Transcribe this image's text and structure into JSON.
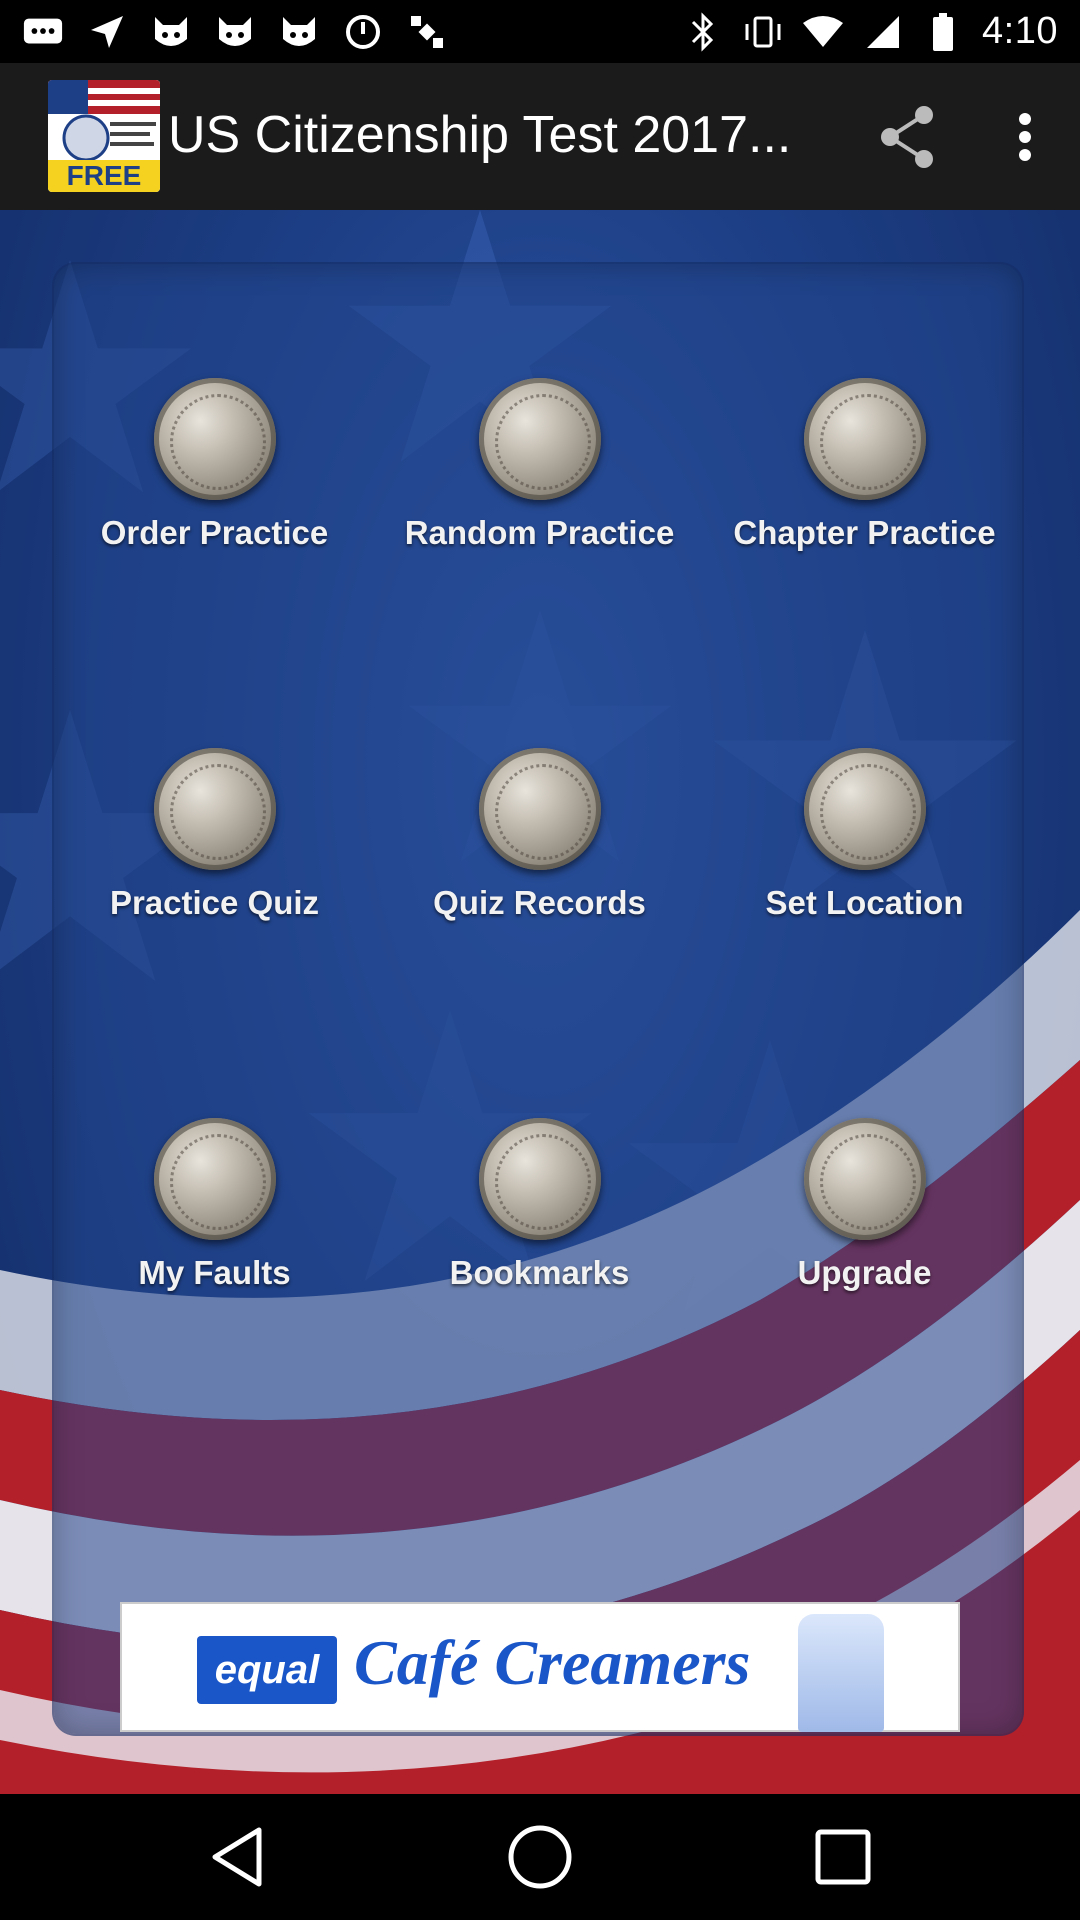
{
  "status_bar": {
    "time": "4:10"
  },
  "app_bar": {
    "logo_text": "FREE",
    "title": "US Citizenship Test 2017..."
  },
  "menu": {
    "items": [
      {
        "label": "Order Practice"
      },
      {
        "label": "Random Practice"
      },
      {
        "label": "Chapter Practice"
      },
      {
        "label": "Practice Quiz"
      },
      {
        "label": "Quiz Records"
      },
      {
        "label": "Set Location"
      },
      {
        "label": "My Faults"
      },
      {
        "label": "Bookmarks"
      },
      {
        "label": "Upgrade"
      }
    ]
  },
  "ad": {
    "brand": "equal",
    "text": "Café Creamers"
  },
  "colors": {
    "background_blue": "#1d3f86",
    "stripe_red": "#b3202a",
    "label_text": "#f2f2f2"
  }
}
